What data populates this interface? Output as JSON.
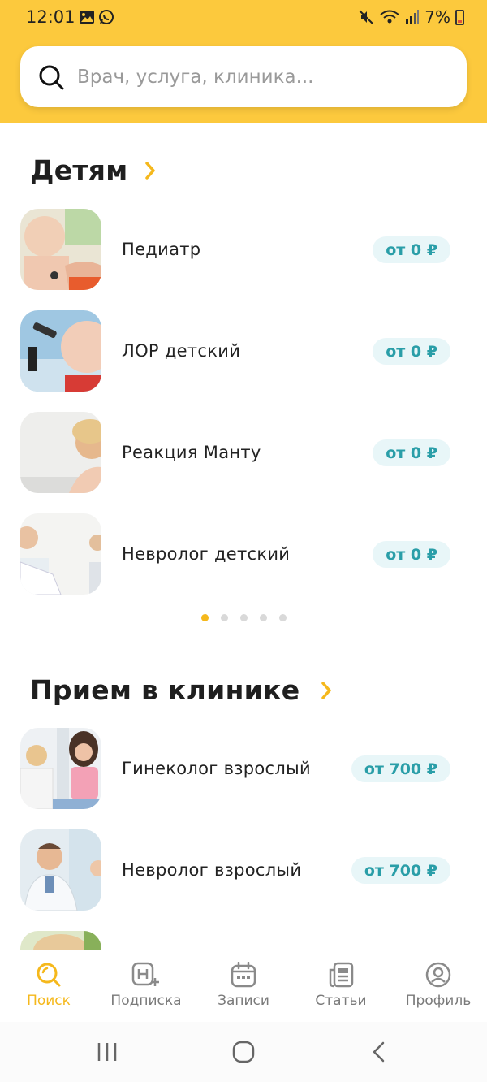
{
  "status_bar": {
    "time": "12:01",
    "battery": "7%"
  },
  "search": {
    "placeholder": "Врач, услуга, клиника..."
  },
  "sections": [
    {
      "title": "Детям",
      "items": [
        {
          "label": "Педиатр",
          "price": "от 0 ₽"
        },
        {
          "label": "ЛОР детский",
          "price": "от 0 ₽"
        },
        {
          "label": "Реакция Манту",
          "price": "от 0 ₽"
        },
        {
          "label": "Невролог детский",
          "price": "от 0 ₽"
        }
      ]
    },
    {
      "title": "Прием в клинике",
      "items": [
        {
          "label": "Гинеколог взрослый",
          "price": "от 700 ₽"
        },
        {
          "label": "Невролог взрослый",
          "price": "от 700 ₽"
        }
      ]
    }
  ],
  "pager": {
    "total": 5,
    "active": 1
  },
  "bottom_nav": [
    {
      "label": "Поиск",
      "icon": "search-icon",
      "active": true
    },
    {
      "label": "Подписка",
      "icon": "hospital-plus-icon",
      "active": false
    },
    {
      "label": "Записи",
      "icon": "calendar-icon",
      "active": false
    },
    {
      "label": "Статьи",
      "icon": "articles-icon",
      "active": false
    },
    {
      "label": "Профиль",
      "icon": "profile-icon",
      "active": false
    }
  ],
  "colors": {
    "accent": "#fcc93d",
    "active_tab": "#f5b81c",
    "price_text": "#2a9ea8",
    "price_bg": "#e8f6f8"
  }
}
